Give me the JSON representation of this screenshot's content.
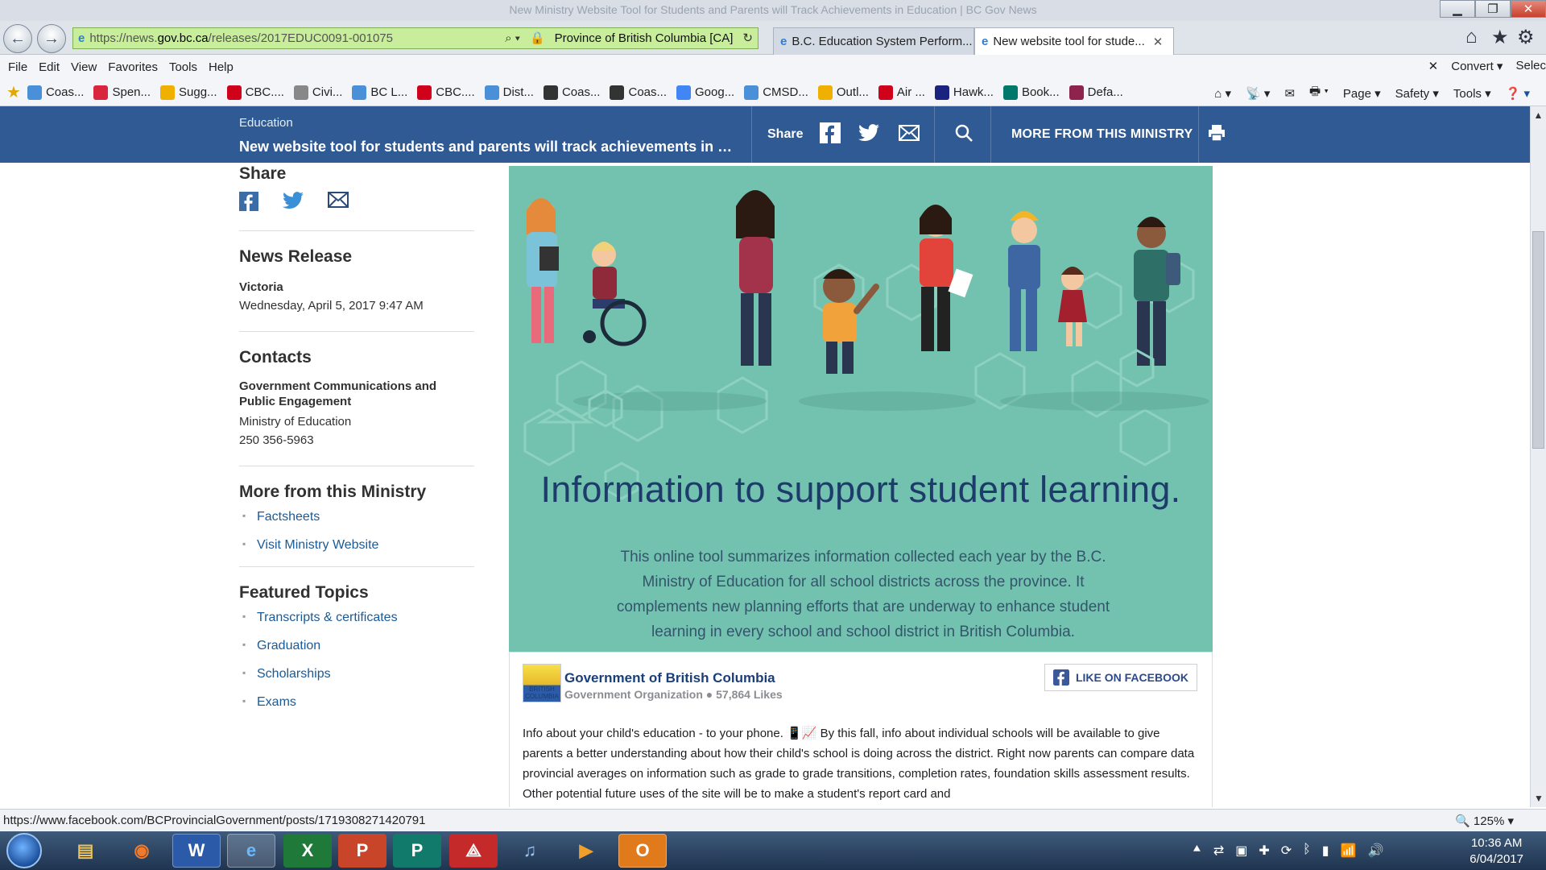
{
  "browser": {
    "window_title": "New Ministry Website Tool for Students and Parents will Track Achievements in Education | BC Gov News",
    "url_prefix": "https://news.",
    "url_domain": "gov.bc.ca",
    "url_path": "/releases/2017EDUC0091-001075",
    "site_identity": "Province of British Columbia [CA]",
    "tabs": [
      {
        "label": "B.C. Education System Perform...",
        "active": false
      },
      {
        "label": "New website tool for stude...",
        "active": true
      }
    ],
    "menu": [
      "File",
      "Edit",
      "View",
      "Favorites",
      "Tools",
      "Help"
    ],
    "menu_right": [
      "Convert",
      "Selec"
    ],
    "favorites": [
      {
        "label": "Coas...",
        "icon": "ie-page-icon",
        "color": "#4a90d9"
      },
      {
        "label": "Spen...",
        "icon": "spen-icon",
        "color": "#d7263d"
      },
      {
        "label": "Sugg...",
        "icon": "bing-icon",
        "color": "#f0b000"
      },
      {
        "label": "CBC....",
        "icon": "cbc-icon",
        "color": "#d0021b"
      },
      {
        "label": "Civi...",
        "icon": "civi-icon",
        "color": "#888888"
      },
      {
        "label": "BC L...",
        "icon": "ie-page-icon",
        "color": "#4a90d9"
      },
      {
        "label": "CBC....",
        "icon": "cbc-icon",
        "color": "#d0021b"
      },
      {
        "label": "Dist...",
        "icon": "ie-page-icon",
        "color": "#4a90d9"
      },
      {
        "label": "Coas...",
        "icon": "coast-icon",
        "color": "#333333"
      },
      {
        "label": "Coas...",
        "icon": "coast-icon",
        "color": "#333333"
      },
      {
        "label": "Goog...",
        "icon": "google-icon",
        "color": "#4285f4"
      },
      {
        "label": "CMSD...",
        "icon": "ie-page-icon",
        "color": "#4a90d9"
      },
      {
        "label": "Outl...",
        "icon": "outlook-icon",
        "color": "#f0b000"
      },
      {
        "label": "Air ...",
        "icon": "aircanada-icon",
        "color": "#d0021b"
      },
      {
        "label": "Hawk...",
        "icon": "hawk-icon",
        "color": "#1a237e"
      },
      {
        "label": "Book...",
        "icon": "book-icon",
        "color": "#00796b"
      },
      {
        "label": "Defa...",
        "icon": "default-icon",
        "color": "#8e244d"
      }
    ],
    "command_bar": [
      "Page",
      "Safety",
      "Tools"
    ],
    "status_url": "https://www.facebook.com/BCProvincialGovernment/posts/1719308271420791",
    "zoom": "125%"
  },
  "site": {
    "breadcrumb": "Education",
    "title": "New website tool for students and parents will track achievements in ed...",
    "share_label": "Share",
    "more_label": "MORE FROM THIS MINISTRY",
    "brand_color": "#2f5a93"
  },
  "sidebar": {
    "share_heading": "Share",
    "news_heading": "News Release",
    "location": "Victoria",
    "datetime": "Wednesday, April 5, 2017 9:47 AM",
    "contacts_heading": "Contacts",
    "contact_org": "Government Communications and Public Engagement",
    "contact_ministry": "Ministry of Education",
    "contact_phone": "250 356-5963",
    "ministry_heading": "More from this Ministry",
    "ministry_links": [
      "Factsheets",
      "Visit Ministry Website"
    ],
    "topics_heading": "Featured Topics",
    "topic_links": [
      "Transcripts & certificates",
      "Graduation",
      "Scholarships",
      "Exams"
    ]
  },
  "hero": {
    "headline": "Information to support student learning.",
    "body": "This online tool summarizes information collected each year by the B.C. Ministry of Education for all school districts across the province. It complements new planning efforts that are underway to enhance student learning in every school and school district in British Columbia."
  },
  "facebook": {
    "page_name": "Government of British Columbia",
    "meta": "Government Organization ● 57,864 Likes",
    "like_button": "LIKE ON FACEBOOK",
    "logo_text": "BRITISH COLUMBIA",
    "post_text": "Info about your child's education - to your phone. 📱📈 By this fall, info about individual schools will be available to give parents a better understanding about how their child's school is doing across the district. Right now parents can compare data provincial averages on information such as grade to grade transitions, completion rates, foundation skills assessment results. Other potential future uses of the site will be to make a student's report card and"
  },
  "taskbar": {
    "time": "10:36 AM",
    "date": "6/04/2017"
  }
}
